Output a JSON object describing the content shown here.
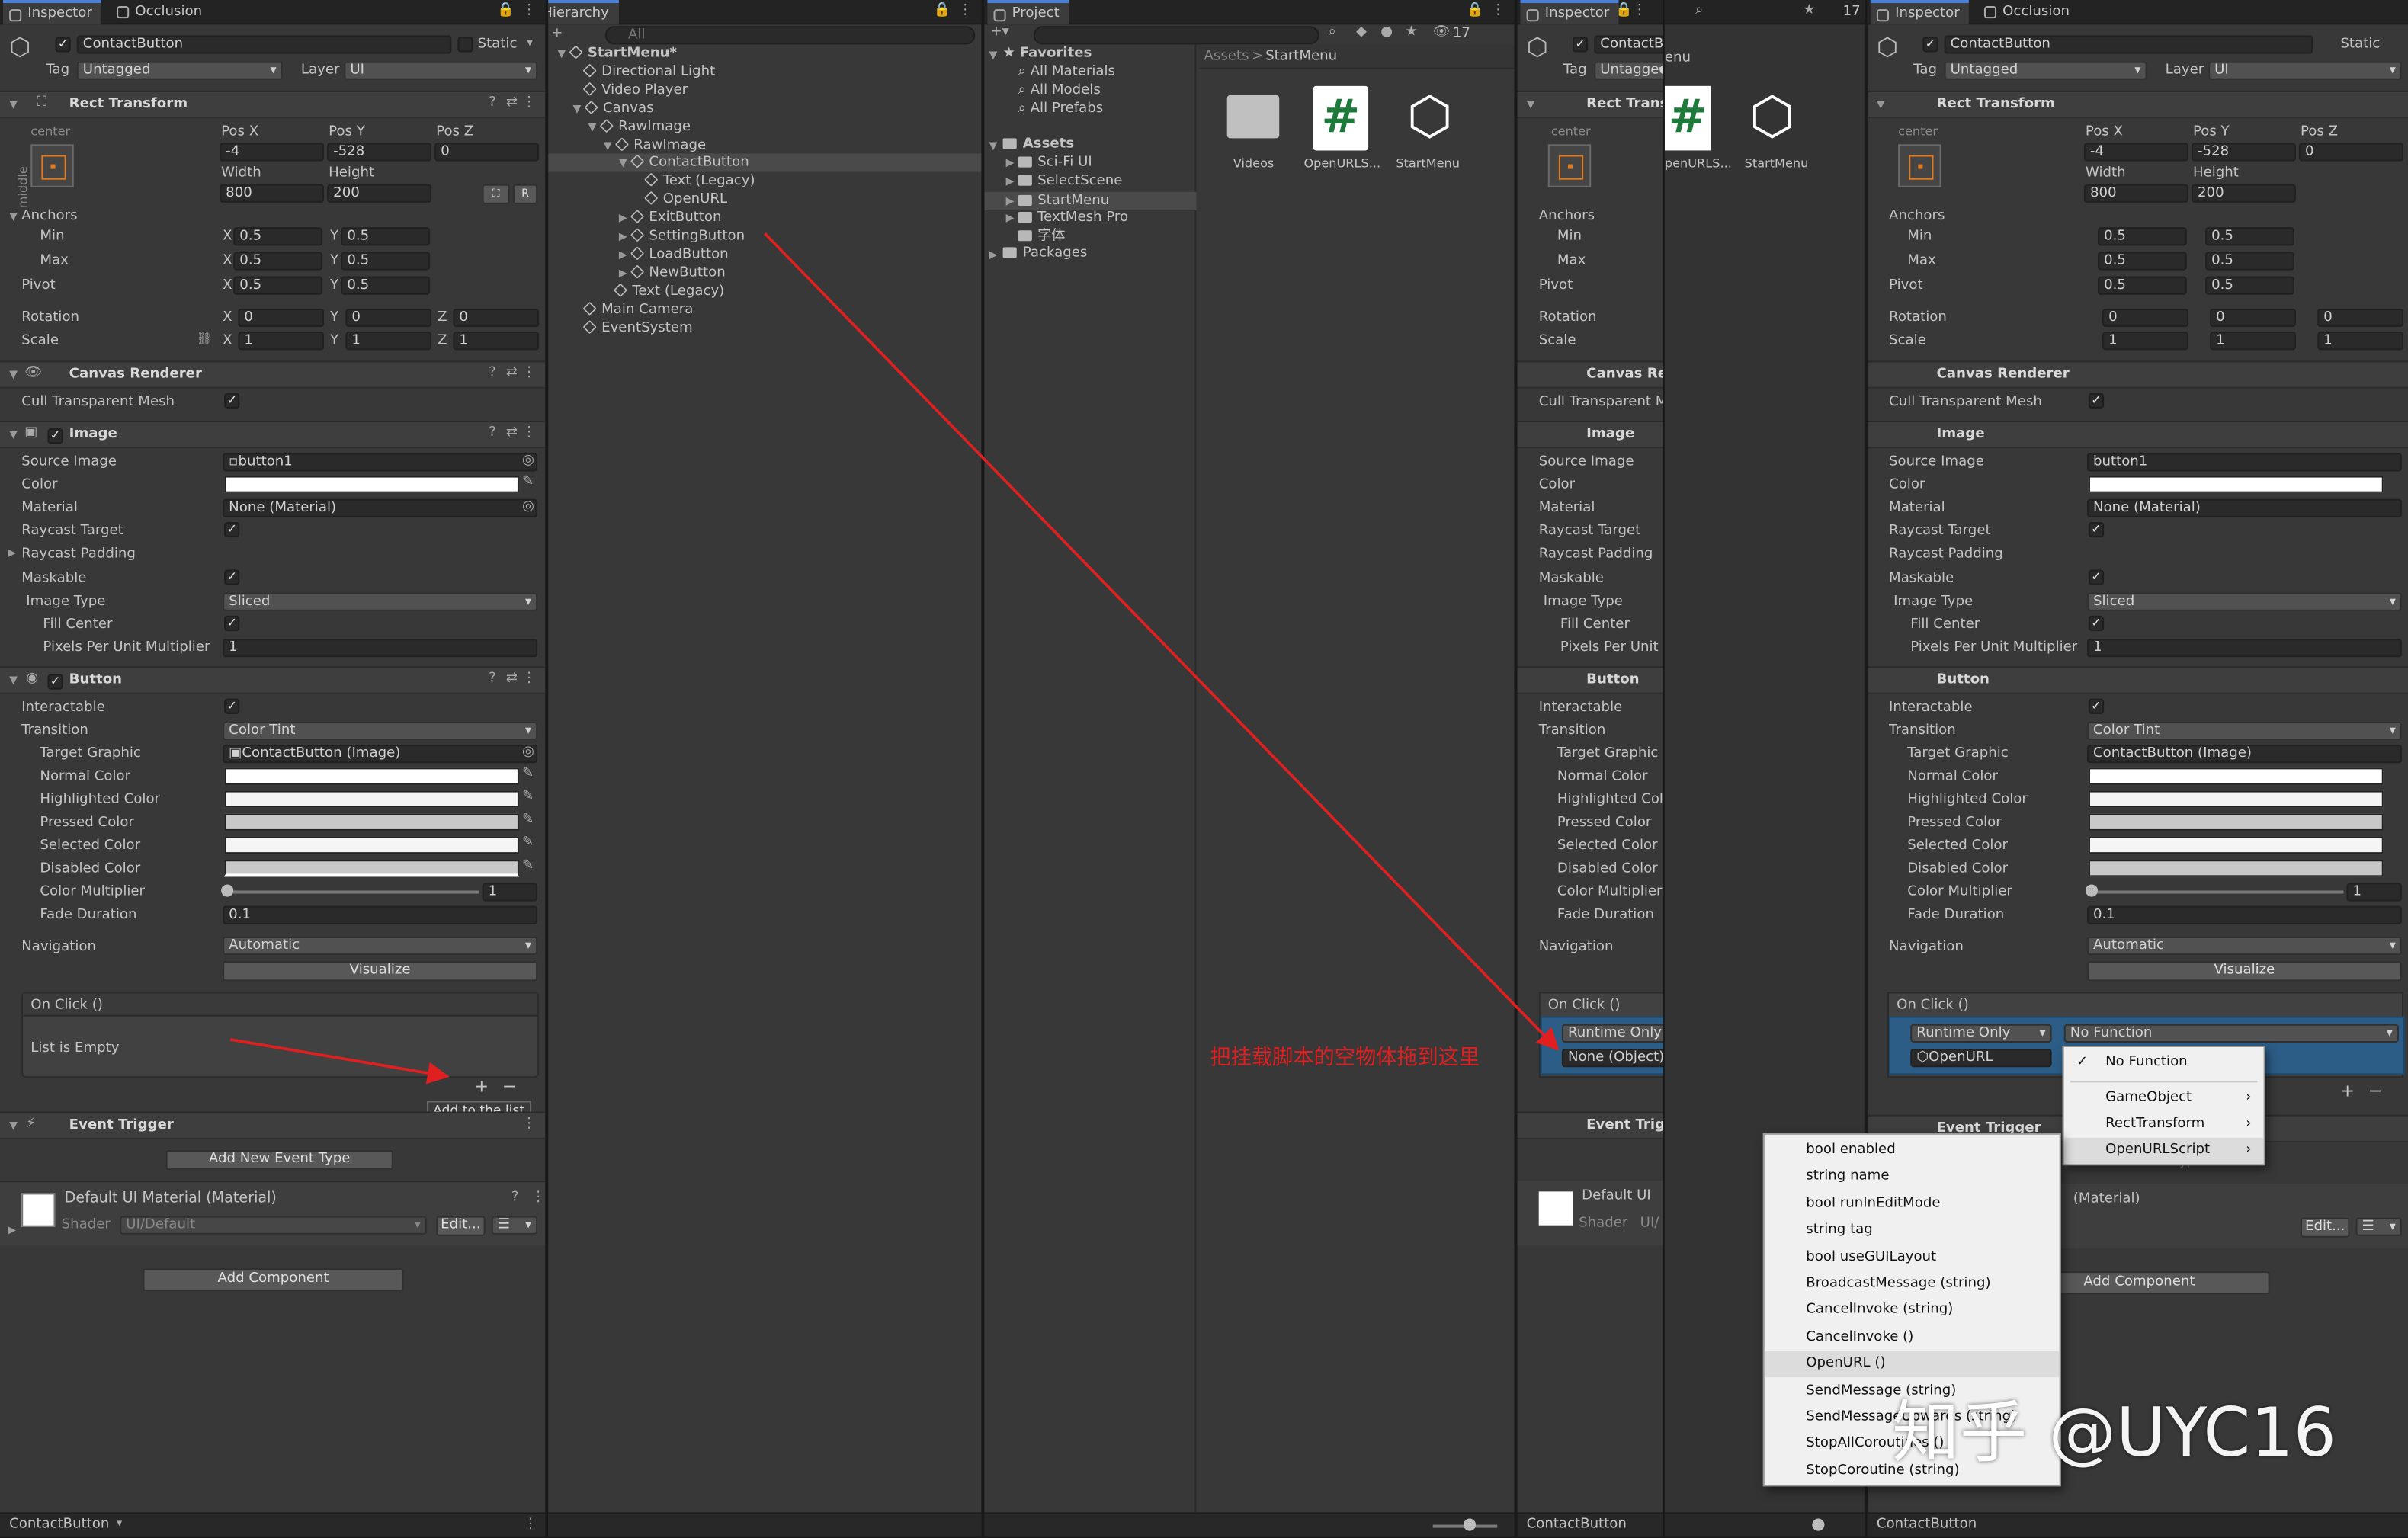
{
  "colors": {
    "accent": "#4c7fd6",
    "annotation_red": "#e02020",
    "selection_blue": "#2c5d87"
  },
  "inspector_tabs": [
    "Inspector",
    "Occlusion"
  ],
  "hierarchy_tab": "Hierarchy",
  "project_tab": "Project",
  "object": {
    "name": "ContactButton",
    "static_label": "Static",
    "tag_label": "Tag",
    "tag_value": "Untagged",
    "layer_label": "Layer",
    "layer_value": "UI"
  },
  "rect_transform": {
    "title": "Rect Transform",
    "anchor_preset_top": "center",
    "anchor_preset_side": "middle",
    "posx_label": "Pos X",
    "posy_label": "Pos Y",
    "posz_label": "Pos Z",
    "posx": "-4",
    "posy": "-528",
    "posz": "0",
    "width_label": "Width",
    "height_label": "Height",
    "width": "800",
    "height": "200",
    "r_btn": "R",
    "anchors": "Anchors",
    "min": "Min",
    "max": "Max",
    "pivot": "Pivot",
    "rotation": "Rotation",
    "scale": "Scale",
    "x": "X",
    "y": "Y",
    "z": "Z",
    "min_x": "0.5",
    "min_y": "0.5",
    "max_x": "0.5",
    "max_y": "0.5",
    "pivot_x": "0.5",
    "pivot_y": "0.5",
    "rot_x": "0",
    "rot_y": "0",
    "rot_z": "0",
    "scale_x": "1",
    "scale_y": "1",
    "scale_z": "1"
  },
  "canvas_renderer": {
    "title": "Canvas Renderer",
    "cull": "Cull Transparent Mesh"
  },
  "image": {
    "title": "Image",
    "source_image": "Source Image",
    "source_value": "button1",
    "color": "Color",
    "material": "Material",
    "material_value": "None (Material)",
    "raycast_target": "Raycast Target",
    "raycast_padding": "Raycast Padding",
    "maskable": "Maskable",
    "image_type": "Image Type",
    "image_type_value": "Sliced",
    "fill_center": "Fill Center",
    "ppu": "Pixels Per Unit Multiplier",
    "ppu_value": "1"
  },
  "button": {
    "title": "Button",
    "interactable": "Interactable",
    "transition": "Transition",
    "transition_value": "Color Tint",
    "target_graphic": "Target Graphic",
    "target_value": "ContactButton (Image)",
    "normal": "Normal Color",
    "highlighted": "Highlighted Color",
    "pressed": "Pressed Color",
    "selected": "Selected Color",
    "disabled": "Disabled Color",
    "multiplier": "Color Multiplier",
    "multiplier_value": "1",
    "fade": "Fade Duration",
    "fade_value": "0.1",
    "navigation": "Navigation",
    "navigation_value": "Automatic",
    "visualize": "Visualize",
    "onclick": "On Click ()",
    "list_empty": "List is Empty",
    "plus": "+",
    "minus": "−",
    "tooltip": "Add to the list"
  },
  "event_trigger": {
    "title": "Event Trigger",
    "add_event": "Add New Event Type"
  },
  "material": {
    "title": "Default UI Material (Material)",
    "shader_label": "Shader",
    "shader_value": "UI/Default",
    "edit": "Edit...",
    "list_icon": "☰"
  },
  "add_component": "Add Component",
  "status_label": "ContactButton",
  "hierarchy": {
    "search": "All",
    "items": [
      {
        "label": "StartMenu*",
        "level": 0,
        "icon": "scene"
      },
      {
        "label": "Directional Light",
        "level": 1,
        "icon": "cube"
      },
      {
        "label": "Video Player",
        "level": 1,
        "icon": "cube"
      },
      {
        "label": "Canvas",
        "level": 1,
        "icon": "cube"
      },
      {
        "label": "RawImage",
        "level": 2,
        "icon": "cube"
      },
      {
        "label": "RawImage",
        "level": 3,
        "icon": "cube"
      },
      {
        "label": "ContactButton",
        "level": 4,
        "icon": "cube"
      },
      {
        "label": "Text (Legacy)",
        "level": 5,
        "icon": "cube"
      },
      {
        "label": "OpenURL",
        "level": 5,
        "icon": "cube"
      },
      {
        "label": "ExitButton",
        "level": 4,
        "icon": "cube"
      },
      {
        "label": "SettingButton",
        "level": 4,
        "icon": "cube"
      },
      {
        "label": "LoadButton",
        "level": 4,
        "icon": "cube"
      },
      {
        "label": "NewButton",
        "level": 4,
        "icon": "cube"
      },
      {
        "label": "Text (Legacy)",
        "level": 3,
        "icon": "cube"
      },
      {
        "label": "Main Camera",
        "level": 1,
        "icon": "cube"
      },
      {
        "label": "EventSystem",
        "level": 1,
        "icon": "cube"
      }
    ]
  },
  "project": {
    "badge": "17",
    "favorites": "Favorites",
    "fav_items": [
      "All Materials",
      "All Models",
      "All Prefabs"
    ],
    "assets": "Assets",
    "asset_items": [
      "Sci-Fi UI",
      "SelectScene",
      "StartMenu",
      "TextMesh Pro",
      "字体"
    ],
    "packages": "Packages",
    "breadcrumb_root": "Assets",
    "breadcrumb_sep": ">",
    "breadcrumb_leaf": "StartMenu",
    "files": [
      {
        "name": "Videos",
        "kind": "folder"
      },
      {
        "name": "OpenURLS...",
        "kind": "script"
      },
      {
        "name": "StartMenu",
        "kind": "unity"
      }
    ]
  },
  "right_panel": {
    "partial_name": "ContactB",
    "partial_tag": "Untagged",
    "hierarchy_partial": "enu",
    "files_partial": [
      "penURLS...",
      "StartMenu"
    ],
    "badge": "17",
    "canvas_partial": "Canvas Re",
    "cull_partial": "Cull Transparent M",
    "ppu_partial": "Pixels Per Unit",
    "highlighted_partial": "Highlighted Col",
    "event_partial": "Event Trig",
    "material_partial": "Default UI",
    "shader_partial": "UI/",
    "rect_partial": "Rect Trans",
    "runtime": "Runtime Only",
    "none_object": "None (Object)",
    "no_function": "No Function",
    "openurl_ref": "OpenURL",
    "material_suffix": "(Material)",
    "add_new_partial": "Add New Event Type"
  },
  "annotation": "把挂载脚本的空物体拖到这里",
  "function_menu": {
    "items": [
      {
        "label": "No Function",
        "checked": true
      },
      {
        "label": "GameObject",
        "sub": true
      },
      {
        "label": "RectTransform",
        "sub": true
      },
      {
        "label": "OpenURLScript",
        "sub": true,
        "hl": true
      }
    ]
  },
  "method_menu": {
    "items": [
      "bool enabled",
      "string name",
      "bool runInEditMode",
      "string tag",
      "bool useGUILayout",
      "BroadcastMessage (string)",
      "CancelInvoke (string)",
      "CancelInvoke ()",
      "OpenURL ()",
      "SendMessage (string)",
      "SendMessageUpwards (string)",
      "StopAllCoroutines ()",
      "StopCoroutine (string)"
    ],
    "highlight": "OpenURL ()"
  },
  "watermark": "知乎 @UYC16"
}
